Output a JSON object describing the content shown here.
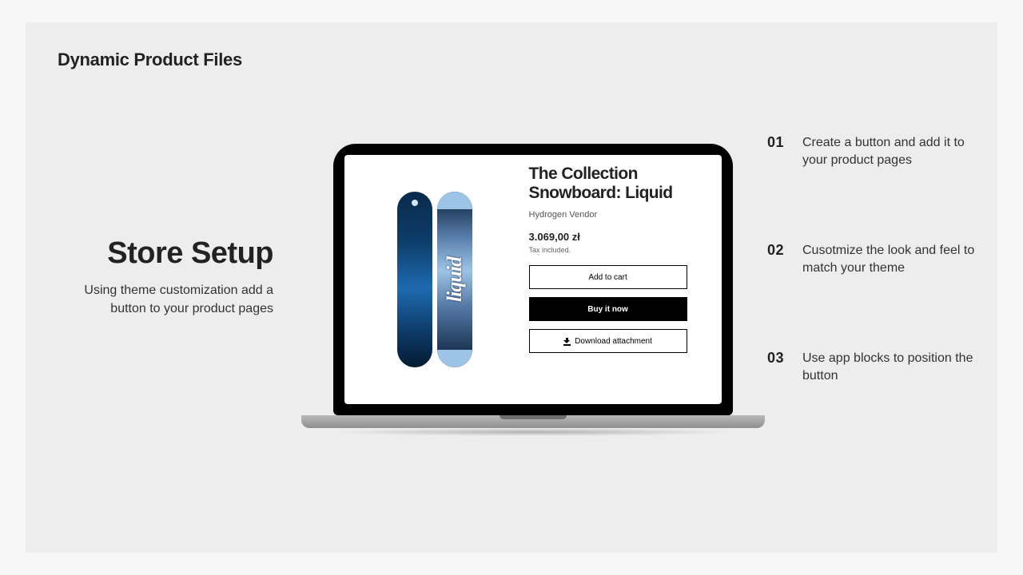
{
  "brand": "Dynamic Product Files",
  "left": {
    "title": "Store Setup",
    "subtitle": "Using theme customization add a button to your product pages"
  },
  "steps": [
    {
      "num": "01",
      "text": "Create a button and add it to your product pages"
    },
    {
      "num": "02",
      "text": "Cusotmize the look and feel to match your theme"
    },
    {
      "num": "03",
      "text": "Use app blocks to position the button"
    }
  ],
  "product": {
    "title": "The Collection Snowboard: Liquid",
    "vendor": "Hydrogen Vendor",
    "price": "3.069,00 zł",
    "tax_note": "Tax included.",
    "board_word": "liquid",
    "buttons": {
      "add_to_cart": "Add to cart",
      "buy_now": "Buy it now",
      "download": "Download attachment"
    }
  }
}
